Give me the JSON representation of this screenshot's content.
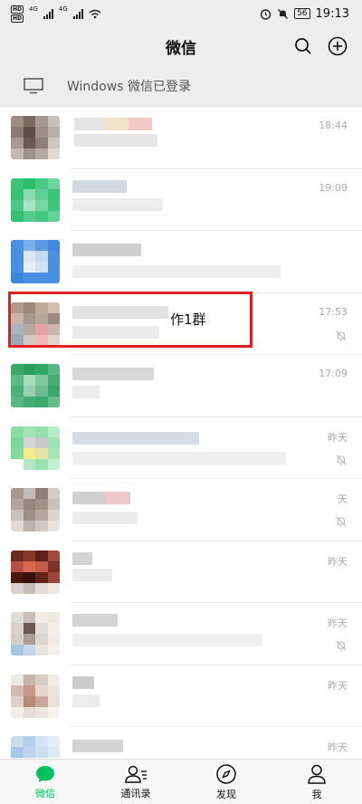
{
  "status_bar": {
    "network_left": "HD",
    "network_left2": "HD",
    "signal1": "4G",
    "signal2": "4G",
    "battery": "56",
    "time": "19:13"
  },
  "header": {
    "title": "微信"
  },
  "login_notice": {
    "text": "Windows 微信已登录"
  },
  "chats": [
    {
      "time": "18:44",
      "muted": false
    },
    {
      "time": "19:09",
      "muted": false
    },
    {
      "time": "",
      "muted": false
    },
    {
      "name_suffix": "作1群",
      "time": "17:53",
      "muted": true
    },
    {
      "time": "17:09",
      "muted": false
    },
    {
      "time": "昨天",
      "muted": true
    },
    {
      "time": "天",
      "muted": true
    },
    {
      "time": "昨天",
      "muted": false
    },
    {
      "time": "昨天",
      "muted": true
    },
    {
      "time": "昨天",
      "muted": false
    },
    {
      "time": "昨天",
      "muted": false
    }
  ],
  "tabs": [
    {
      "label": "微信",
      "icon": "chat-bubble-icon",
      "active": true
    },
    {
      "label": "通讯录",
      "icon": "contacts-icon",
      "active": false
    },
    {
      "label": "发现",
      "icon": "compass-icon",
      "active": false
    },
    {
      "label": "我",
      "icon": "person-icon",
      "active": false
    }
  ],
  "colors": {
    "accent": "#07c160",
    "highlight": "#e02020"
  }
}
